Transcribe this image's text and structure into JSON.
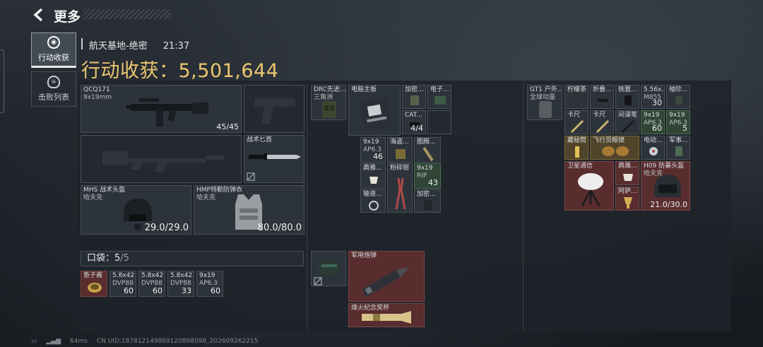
{
  "header": {
    "title": "更多"
  },
  "sidebar": {
    "tabs": [
      {
        "label": "行动收获",
        "icon": "target-icon"
      },
      {
        "label": "击败列表",
        "icon": "skull-icon"
      }
    ]
  },
  "raid": {
    "location": "航天基地-绝密",
    "time": "21:37",
    "value_label": "行动收获：",
    "value": "5,501,644"
  },
  "equipment": {
    "primary": {
      "name": "QCQ171",
      "caliber": "9x19mm",
      "ammo": "45/45"
    },
    "knife": {
      "name": "战术匕首"
    },
    "helmet": {
      "name": "MHS 战术头盔",
      "brand": "哈夫克",
      "durability": "29.0/29.0"
    },
    "armor": {
      "name": "HMP特勤防弹衣",
      "brand": "哈夫克",
      "durability": "80.0/80.0"
    }
  },
  "pocket": {
    "label": "口袋：",
    "used": "5",
    "capacity": "/5",
    "items": [
      {
        "name": "鱼子酱",
        "sub": "",
        "count": ""
      },
      {
        "name": "5.8x42",
        "sub": "DVP88",
        "count": "60"
      },
      {
        "name": "5.8x42",
        "sub": "DVP88",
        "count": "60"
      },
      {
        "name": "5.8x42",
        "sub": "DVP88",
        "count": "33"
      },
      {
        "name": "9x19",
        "sub": "AP6.3",
        "count": "60"
      }
    ]
  },
  "bag": {
    "rig": {
      "name": "DRC先进...",
      "sub": "三角洲"
    },
    "items": [
      {
        "name": "电脑主板",
        "count": ""
      },
      {
        "name": "加密...",
        "count": ""
      },
      {
        "name": "电子...",
        "count": ""
      },
      {
        "name": "CAT...",
        "count": "4/4"
      },
      {
        "name": "9x19",
        "sub": "AP6.3",
        "count": "46"
      },
      {
        "name": "海盗...",
        "count": ""
      },
      {
        "name": "图腾...",
        "count": ""
      },
      {
        "name": "典雅...",
        "count": ""
      },
      {
        "name": "粉碎钳",
        "count": ""
      },
      {
        "name": "9x19",
        "sub": "RIP",
        "count": "43"
      },
      {
        "name": "输液...",
        "count": ""
      },
      {
        "name": "加密...",
        "count": ""
      }
    ],
    "extra": [
      {
        "name": "军用炮弹",
        "count": ""
      },
      {
        "name": "烽火纪念奖杯",
        "count": ""
      }
    ]
  },
  "case": {
    "rig": {
      "name": "GT1 户外...",
      "sub": "全球动量"
    },
    "items": [
      {
        "name": "柠檬茶",
        "count": ""
      },
      {
        "name": "折叠...",
        "count": ""
      },
      {
        "name": "侧置...",
        "count": ""
      },
      {
        "name": "5.56x...",
        "sub": "M855",
        "count": "30"
      },
      {
        "name": "袖珍...",
        "count": ""
      },
      {
        "name": "卡尺",
        "count": ""
      },
      {
        "name": "卡尺",
        "count": ""
      },
      {
        "name": "间谍笔",
        "count": ""
      },
      {
        "name": "9x19",
        "sub": "AP6.3",
        "count": "60"
      },
      {
        "name": "9x19",
        "sub": "AP6.3",
        "count": "5"
      },
      {
        "name": "藏秘筒",
        "count": ""
      },
      {
        "name": "飞行员眼镜",
        "count": ""
      },
      {
        "name": "电动...",
        "count": ""
      },
      {
        "name": "军事...",
        "count": ""
      },
      {
        "name": "卫星通信",
        "count": ""
      },
      {
        "name": "典雅...",
        "count": ""
      },
      {
        "name": "阿萨...",
        "count": ""
      },
      {
        "name": "H09 防暴头盔",
        "sub": "哈夫克",
        "count": "21.0/30.0"
      }
    ]
  },
  "footer": {
    "ping": "64ms",
    "uid": "CN UID:187812149869120898098_202609262215"
  },
  "colors": {
    "gold": "#ecc770",
    "red_rarity": "#6e3030",
    "gold_rarity": "#5c4e2a",
    "green_rarity": "#344e3a"
  }
}
